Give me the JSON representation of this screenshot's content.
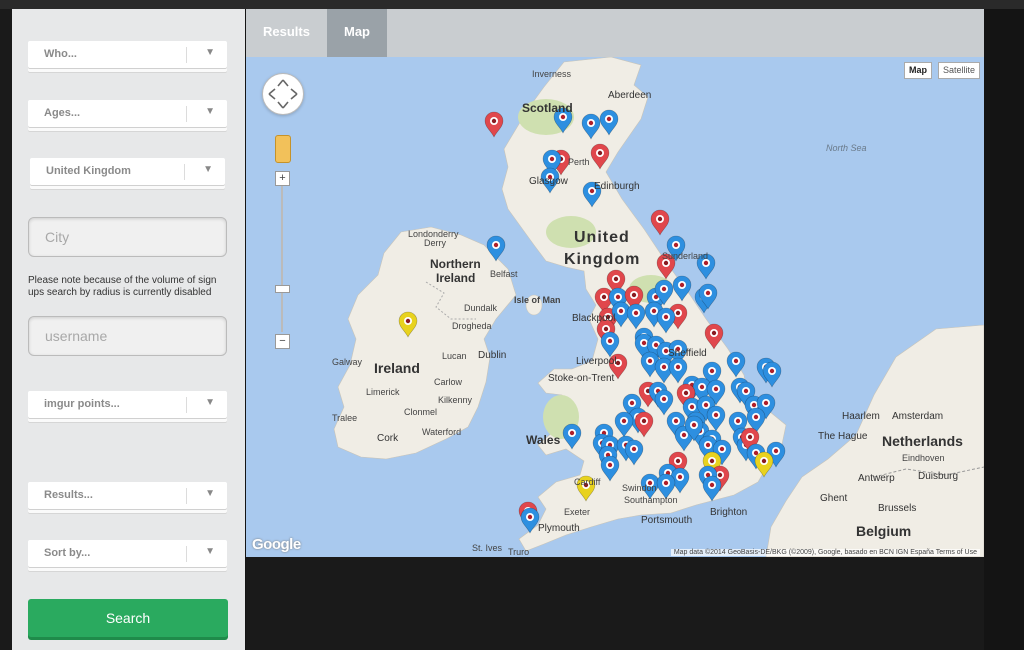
{
  "sidebar": {
    "filters": {
      "who_label": "Who...",
      "ages_label": "Ages...",
      "country_label": "United Kingdom",
      "imgur_points_label": "imgur points...",
      "results_label": "Results...",
      "sort_label": "Sort by..."
    },
    "city_placeholder": "City",
    "radius_note": "Please note because of the volume of sign ups search by radius is currently disabled",
    "username_placeholder": "username",
    "search_label": "Search",
    "dropdown_arrow": "▼"
  },
  "tabs": [
    {
      "label": "Results",
      "active": false
    },
    {
      "label": "Map",
      "active": true
    }
  ],
  "map": {
    "type_controls": {
      "map": "Map",
      "satellite": "Satellite"
    },
    "zoom_in": "+",
    "zoom_out": "−",
    "logo": "Google",
    "attribution": "Map data ©2014 GeoBasis-DE/BKG (©2009), Google, basado en BCN IGN España   Terms of Use",
    "labels": {
      "inverness": "Inverness",
      "aberdeen": "Aberdeen",
      "scotland": "Scotland",
      "perth": "Perth",
      "glasgow": "Glasgow",
      "edinburgh": "Edinburgh",
      "united": "United",
      "kingdom": "Kingdom",
      "sunderland": "Sunderland",
      "north_sea": "North Sea",
      "londonderry": "Londonderry",
      "derry": "Derry",
      "northern": "Northern",
      "ireland_ni": "Ireland",
      "belfast": "Belfast",
      "isle_of_man": "Isle of Man",
      "dundalk": "Dundalk",
      "drogheda": "Drogheda",
      "blackpool": "Blackpool",
      "galway": "Galway",
      "lucan": "Lucan",
      "dublin": "Dublin",
      "ireland": "Ireland",
      "liverpool": "Liverpool",
      "sheffield": "Sheffield",
      "stoke": "Stoke-on-Trent",
      "limerick": "Limerick",
      "carlow": "Carlow",
      "kilkenny": "Kilkenny",
      "clonmel": "Clonmel",
      "tralee": "Tralee",
      "waterford": "Waterford",
      "cork": "Cork",
      "wales": "Wales",
      "haarlem": "Haarlem",
      "amsterdam": "Amsterdam",
      "hague": "The Hague",
      "netherlands": "Netherlands",
      "eindhoven": "Eindhoven",
      "antwerp": "Antwerp",
      "duisburg": "Duisburg",
      "cardiff": "Cardiff",
      "swindon": "Swindon",
      "exeter": "Exeter",
      "southampton": "Southampton",
      "portsmouth": "Portsmouth",
      "brighton": "Brighton",
      "ghent": "Ghent",
      "brussels": "Brussels",
      "belgium": "Belgium",
      "plymouth": "Plymouth",
      "st_ives": "St. Ives",
      "truro": "Truro"
    }
  },
  "colors": {
    "sea": "#a9c9ee",
    "land": "#f0ede5",
    "green": "#cfe0b0",
    "search": "#2aaa5f",
    "pin_red": "#e0474c",
    "pin_blue": "#2d8fe0",
    "pin_yellow": "#e8d21e"
  },
  "pin_legend": {
    "red": "red-pin",
    "blue": "blue-pin",
    "yellow": "yellow-pin"
  }
}
